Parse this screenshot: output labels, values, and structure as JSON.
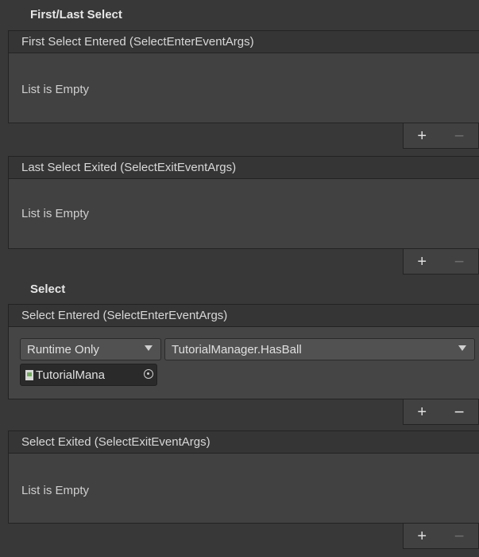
{
  "sections": {
    "first_last": "First/Last Select",
    "select": "Select"
  },
  "events": [
    {
      "title": "First Select Entered (SelectEnterEventArgs)",
      "empty_text": "List is Empty",
      "remove_enabled": false
    },
    {
      "title": "Last Select Exited (SelectExitEventArgs)",
      "empty_text": "List is Empty",
      "remove_enabled": false
    },
    {
      "title": "Select Entered (SelectEnterEventArgs)",
      "remove_enabled": true,
      "listener": {
        "call_state": "Runtime Only",
        "function": "TutorialManager.HasBall",
        "target_object": "TutorialMana"
      }
    },
    {
      "title": "Select Exited (SelectExitEventArgs)",
      "empty_text": "List is Empty",
      "remove_enabled": false
    }
  ],
  "buttons": {
    "add": "+",
    "remove": "−"
  },
  "icons": {
    "add": "plus-icon",
    "remove": "minus-icon",
    "dropdown": "chevron-down-icon",
    "object_picker": "object-picker-icon",
    "script": "script-icon"
  }
}
